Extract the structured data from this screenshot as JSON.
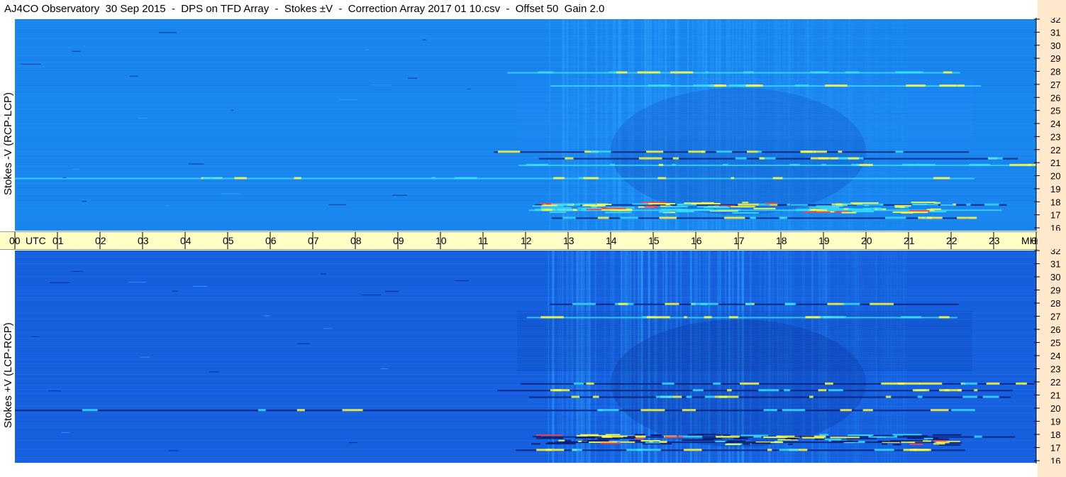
{
  "title": "AJ4CO Observatory  30 Sep 2015  -  DPS on TFD Array  -  Stokes ±V  -  Correction Array 2017 01 10.csv  -  Offset 50  Gain 2.0",
  "panels": [
    {
      "id": "top",
      "ylabel": "Stokes -V (RCP-LCP)"
    },
    {
      "id": "bottom",
      "ylabel": "Stokes +V (LCP-RCP)"
    }
  ],
  "chart_data": {
    "type": "heatmap",
    "x_axis": {
      "unit_label_start": "UTC",
      "unit_label_end": "MHz",
      "ticks": [
        "00",
        "01",
        "02",
        "03",
        "04",
        "05",
        "06",
        "07",
        "08",
        "09",
        "10",
        "11",
        "12",
        "13",
        "14",
        "15",
        "16",
        "17",
        "18",
        "19",
        "20",
        "21",
        "22",
        "23",
        "00"
      ],
      "range_hours": [
        0,
        24
      ]
    },
    "y_axis": {
      "unit": "MHz",
      "range": [
        16,
        32
      ],
      "ticks": [
        "32",
        "31",
        "30",
        "29",
        "28",
        "27",
        "26",
        "25",
        "24",
        "23",
        "22",
        "21",
        "20",
        "19",
        "18",
        "17",
        "16"
      ]
    },
    "colors": {
      "background_top": "#1a86f0",
      "background_bottom": "#1660e0",
      "weak": "#2fa8ff",
      "strong": "#38e0ff",
      "hot": "#ffff40",
      "hottest": "#ff4040",
      "dark": "#0a1a70"
    },
    "features": {
      "interference_bands_mhz": [
        17.0,
        17.6,
        18.0,
        20.0,
        21.0,
        21.5,
        22.0,
        27.0,
        28.0
      ],
      "broadband_brightening_utc": [
        11,
        22
      ],
      "strongest_emission_utc": [
        12,
        22
      ]
    }
  }
}
